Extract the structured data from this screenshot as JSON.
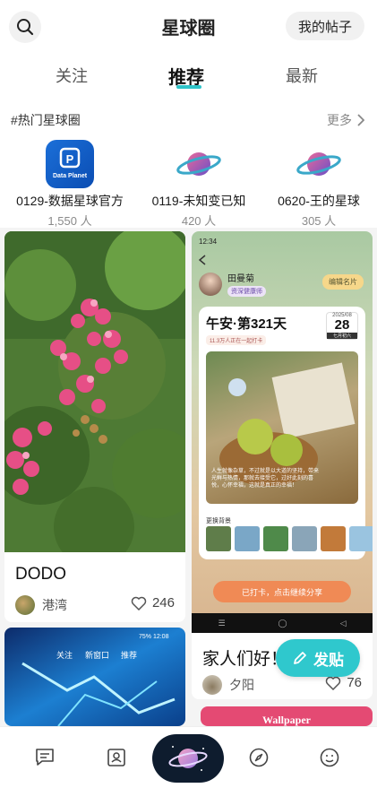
{
  "header": {
    "title": "星球圈",
    "my_posts": "我的帖子"
  },
  "tabs": [
    {
      "label": "关注",
      "active": false
    },
    {
      "label": "推荐",
      "active": true
    },
    {
      "label": "最新",
      "active": false
    }
  ],
  "hot": {
    "title": "#热门星球圈",
    "more": "更多",
    "planets": [
      {
        "name": "0129-数据星球官方",
        "count": "1,550 人",
        "logo_text": "Data Planet",
        "logo": "data-planet-logo"
      },
      {
        "name": "0119-未知变已知",
        "count": "420 人",
        "logo": "planet-icon"
      },
      {
        "name": "0620-王的星球",
        "count": "305 人",
        "logo": "planet-icon"
      }
    ]
  },
  "feed": [
    {
      "title": "DODO",
      "author": "港湾",
      "likes": "246",
      "image": "flowering-tree-photo"
    },
    {
      "title": "家人们好！",
      "author": "夕阳",
      "likes": "76",
      "screenshot": {
        "status_time": "12:34",
        "user_name": "田曼菊",
        "user_tag": "资深健康师",
        "edit_button": "编辑名片",
        "greeting": "午安·第321天",
        "checkin_count": "11.3万人正在一起打卡",
        "date_ym": "2025/08",
        "date_day": "28",
        "date_lunar": "七月初六",
        "quote": "人生就像杂草，不过就是以大道的坚持，带来光鲜与热情，那就去接受它，过好此刻的喜悦，心怀幸福，这就是真正的幸福！",
        "bg_label": "更换背景",
        "cta": "已打卡，点击继续分享"
      }
    },
    {
      "image": "blue-lightning-screenshot",
      "tabs_preview": [
        "关注",
        "新窗口",
        "推荐"
      ],
      "status": "75%  12:08"
    },
    {
      "image": "pink-wallpaper-banner",
      "banner_text": "Wallpaper"
    }
  ],
  "fab": {
    "label": "发贴"
  },
  "bottom_nav": [
    {
      "name": "messages-icon"
    },
    {
      "name": "contacts-icon"
    },
    {
      "name": "planet-icon",
      "active": true
    },
    {
      "name": "discover-compass-icon"
    },
    {
      "name": "profile-smiley-icon"
    }
  ],
  "colors": {
    "accent": "#2fc8cd",
    "cta": "#f08a55"
  }
}
